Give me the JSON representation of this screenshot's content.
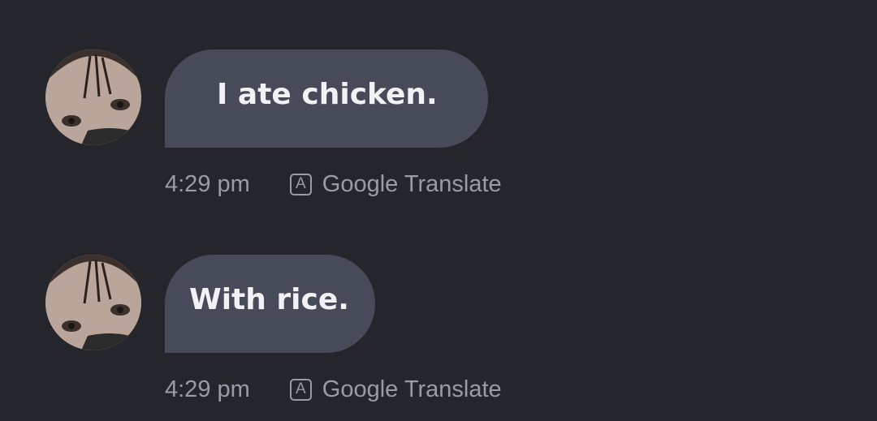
{
  "messages": [
    {
      "text": "I ate chicken.",
      "time": "4:29 pm",
      "translate_label": "Google Translate",
      "translate_icon_glyph": "A"
    },
    {
      "text": "With rice.",
      "time": "4:29 pm",
      "translate_label": "Google Translate",
      "translate_icon_glyph": "A"
    }
  ],
  "colors": {
    "background": "#25252c",
    "bubble": "#474a58",
    "bubble_text": "#f2f2f4",
    "meta_text": "#9a9ba4"
  },
  "icons": {
    "translate": "google-translate-icon",
    "avatar": "user-avatar"
  }
}
